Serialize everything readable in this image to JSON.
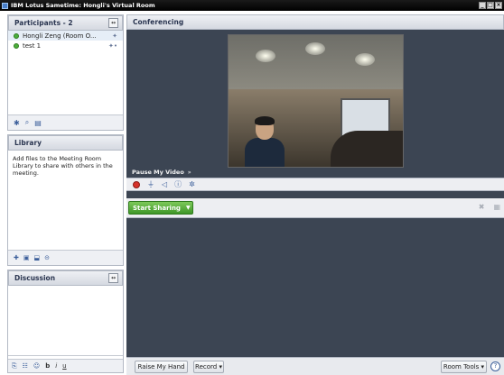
{
  "window": {
    "title": "IBM Lotus Sametime: Hongli's Virtual Room",
    "controls": [
      "_",
      "□",
      "×"
    ]
  },
  "participants": {
    "header": "Participants - 2",
    "menu_icon": "menu-icon",
    "items": [
      {
        "name": "Hongli Zeng (Room O...",
        "status": "available",
        "tag": "✦"
      },
      {
        "name": "test 1",
        "status": "available",
        "tag": "✦•"
      }
    ],
    "tools": [
      "✱",
      "⌕",
      "▤"
    ]
  },
  "library": {
    "header": "Library",
    "description": "Add files to the Meeting Room Library to share with others in the meeting.",
    "tools": [
      "✚",
      "▣",
      "⬓",
      "⊝"
    ]
  },
  "discussion": {
    "header": "Discussion",
    "tools": [
      "⎘",
      "☷",
      "☺",
      "b",
      "i",
      "u"
    ]
  },
  "conferencing": {
    "header": "Conferencing",
    "video_label": "Pause My Video",
    "video_chevron": "»",
    "video_tools": [
      "stop-icon",
      "mic-icon",
      "speaker-icon",
      "info-icon",
      "settings-icon"
    ]
  },
  "sharing": {
    "start_label": "Start Sharing",
    "icons": [
      "✖",
      "▦"
    ]
  },
  "bottom": {
    "raise_hand": "Raise My Hand",
    "record": "Record ▾",
    "room_tools": "Room Tools ▾",
    "help": "?"
  }
}
